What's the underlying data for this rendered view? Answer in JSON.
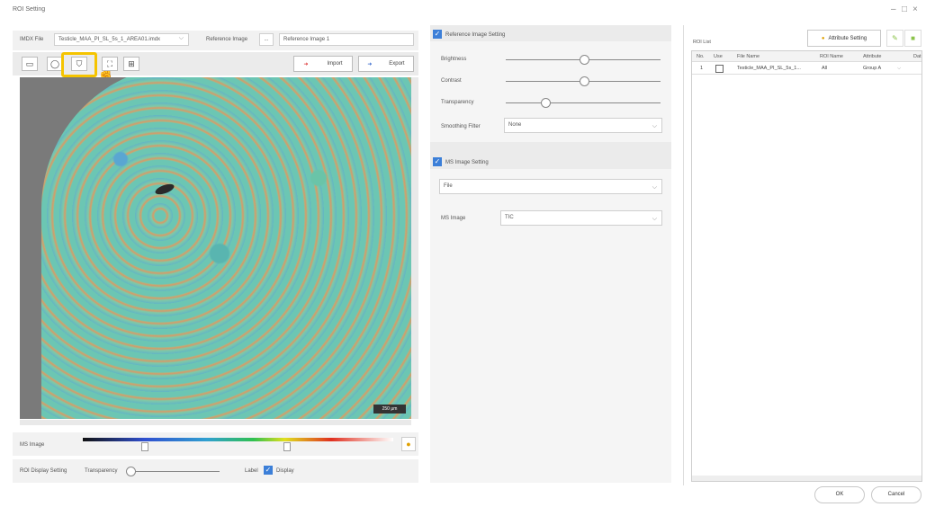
{
  "window": {
    "title": "ROI Setting"
  },
  "file_row": {
    "imdx_label": "IMDX File",
    "imdx_value": "Testicle_MAA_PI_SL_5s_1_AREA01.imdx",
    "ref_label": "Reference Image",
    "browse_label": "...",
    "ref_value": "Reference Image 1"
  },
  "toolbar": {
    "import_label": "Import",
    "export_label": "Export"
  },
  "image": {
    "scalebar": "250 μm"
  },
  "ms_image_row": {
    "label": "MS Image"
  },
  "roi_display": {
    "label": "ROI Display Setting",
    "transparency_label": "Transparency",
    "label_label": "Label",
    "display_label": "Display"
  },
  "reference_setting": {
    "title": "Reference Image Setting",
    "brightness": "Brightness",
    "contrast": "Contrast",
    "transparency": "Transparency",
    "smoothing_label": "Smoothing Filter",
    "smoothing_value": "None"
  },
  "ms_setting": {
    "title": "MS Image Setting",
    "source_value": "File",
    "ms_image_label": "MS Image",
    "ms_image_value": "TIC"
  },
  "roi_list": {
    "title": "ROI List",
    "attribute_button": "Attribute Setting",
    "columns": [
      "No.",
      "Use",
      "File Name",
      "ROI Name",
      "Attribute",
      "Dat"
    ],
    "row": {
      "no": "1",
      "file_name": "Testicle_MAA_PI_SL_5s_1...",
      "roi_name": "All",
      "attribute": "Group A"
    }
  },
  "footer": {
    "ok": "OK",
    "cancel": "Cancel"
  }
}
